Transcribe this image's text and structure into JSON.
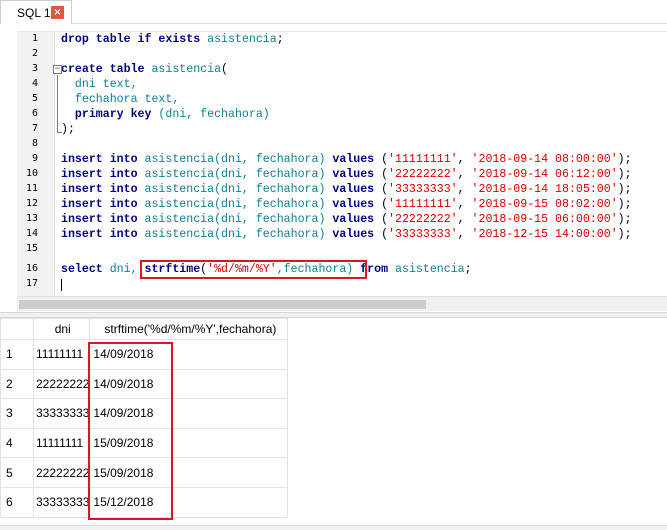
{
  "tab": {
    "label": "SQL 1",
    "close_icon": "close-icon"
  },
  "editor": {
    "lines": [
      {
        "n": "1"
      },
      {
        "n": "2"
      },
      {
        "n": "3"
      },
      {
        "n": "4"
      },
      {
        "n": "5"
      },
      {
        "n": "6"
      },
      {
        "n": "7"
      },
      {
        "n": "8"
      },
      {
        "n": "9"
      },
      {
        "n": "10"
      },
      {
        "n": "11"
      },
      {
        "n": "12"
      },
      {
        "n": "13"
      },
      {
        "n": "14"
      },
      {
        "n": "15"
      },
      {
        "n": "16"
      },
      {
        "n": "17"
      }
    ],
    "code": {
      "l1_kw": "drop table if exists",
      "l1_id": "asistencia",
      "l1_end": ";",
      "l3_kw": "create table",
      "l3_id": "asistencia",
      "l3_end": "(",
      "l4": "  dni text,",
      "l5": "  fechahora text,",
      "l6_kw": "  primary key",
      "l6_rest": " (dni, fechahora)",
      "l7": ");",
      "ins_kw": "insert into",
      "values_kw": "values",
      "tbl": "asistencia",
      "cols": "(dni, fechahora)",
      "rows": [
        {
          "dni": "'11111111'",
          "fh": "'2018-09-14 08:00:00'"
        },
        {
          "dni": "'22222222'",
          "fh": "'2018-09-14 06:12:00'"
        },
        {
          "dni": "'33333333'",
          "fh": "'2018-09-14 18:05:00'"
        },
        {
          "dni": "'11111111'",
          "fh": "'2018-09-15 08:02:00'"
        },
        {
          "dni": "'22222222'",
          "fh": "'2018-09-15 06:00:00'"
        },
        {
          "dni": "'33333333'",
          "fh": "'2018-12-15 14:00:00'"
        }
      ],
      "l16_select": "select",
      "l16_dni": " dni, ",
      "l16_fn": "strftime",
      "l16_open": "(",
      "l16_fmt": "'%d/%m/%Y'",
      "l16_rest": ",fechahora)",
      "l16_from": "from",
      "l16_tbl": "asistencia",
      "l16_end": ";"
    }
  },
  "results": {
    "columns": [
      "dni",
      "strftime('%d/%m/%Y',fechahora)"
    ],
    "rows": [
      {
        "idx": "1",
        "dni": "11111111",
        "fecha": "14/09/2018"
      },
      {
        "idx": "2",
        "dni": "22222222",
        "fecha": "14/09/2018"
      },
      {
        "idx": "3",
        "dni": "33333333",
        "fecha": "14/09/2018"
      },
      {
        "idx": "4",
        "dni": "11111111",
        "fecha": "15/09/2018"
      },
      {
        "idx": "5",
        "dni": "22222222",
        "fecha": "15/09/2018"
      },
      {
        "idx": "6",
        "dni": "33333333",
        "fecha": "15/12/2018"
      }
    ]
  },
  "colors": {
    "highlight": "#e0161e",
    "keyword": "#00007f",
    "identifier": "#0f7f8f",
    "string": "#d40000"
  }
}
